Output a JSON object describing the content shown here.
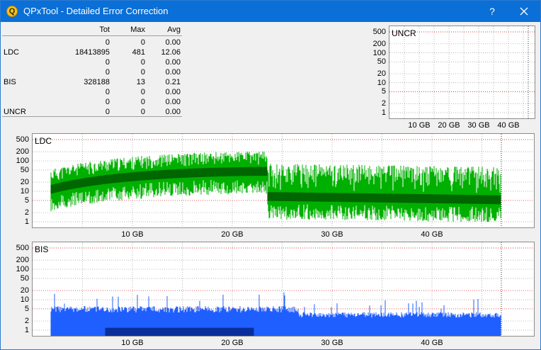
{
  "window": {
    "title": "QPxTool - Detailed Error Correction",
    "help_label": "?",
    "app_icon_letter": "Q"
  },
  "stats": {
    "headers": [
      "Tot",
      "Max",
      "Avg"
    ],
    "rows": [
      {
        "label": "",
        "tot": "0",
        "max": "0",
        "avg": "0.00"
      },
      {
        "label": "LDC",
        "tot": "18413895",
        "max": "481",
        "avg": "12.06"
      },
      {
        "label": "",
        "tot": "0",
        "max": "0",
        "avg": "0.00"
      },
      {
        "label": "",
        "tot": "0",
        "max": "0",
        "avg": "0.00"
      },
      {
        "label": "BIS",
        "tot": "328188",
        "max": "13",
        "avg": "0.21"
      },
      {
        "label": "",
        "tot": "0",
        "max": "0",
        "avg": "0.00"
      },
      {
        "label": "",
        "tot": "0",
        "max": "0",
        "avg": "0.00"
      },
      {
        "label": "UNCR",
        "tot": "0",
        "max": "0",
        "avg": "0.00"
      }
    ]
  },
  "graphs": {
    "uncr": {
      "label": "UNCR",
      "y_ticks": [
        "500",
        "200",
        "100",
        "50",
        "20",
        "10",
        "5",
        "2",
        "1"
      ],
      "x_ticks": [
        "10 GB",
        "20 GB",
        "30 GB",
        "40 GB"
      ]
    },
    "ldc": {
      "label": "LDC",
      "y_ticks": [
        "500",
        "200",
        "100",
        "50",
        "20",
        "10",
        "5",
        "2",
        "1"
      ],
      "x_ticks": [
        "10 GB",
        "20 GB",
        "30 GB",
        "40 GB"
      ]
    },
    "bis": {
      "label": "BIS",
      "y_ticks": [
        "500",
        "200",
        "100",
        "50",
        "20",
        "10",
        "5",
        "2",
        "1"
      ],
      "x_ticks": [
        "10 GB",
        "20 GB",
        "30 GB",
        "40 GB"
      ]
    }
  },
  "colors": {
    "ldc_fill": "#00b000",
    "ldc_dark": "#006600",
    "bis_fill": "#1f5fff",
    "bis_dark": "#0b2f9a",
    "threshold": "#cc0000"
  }
}
